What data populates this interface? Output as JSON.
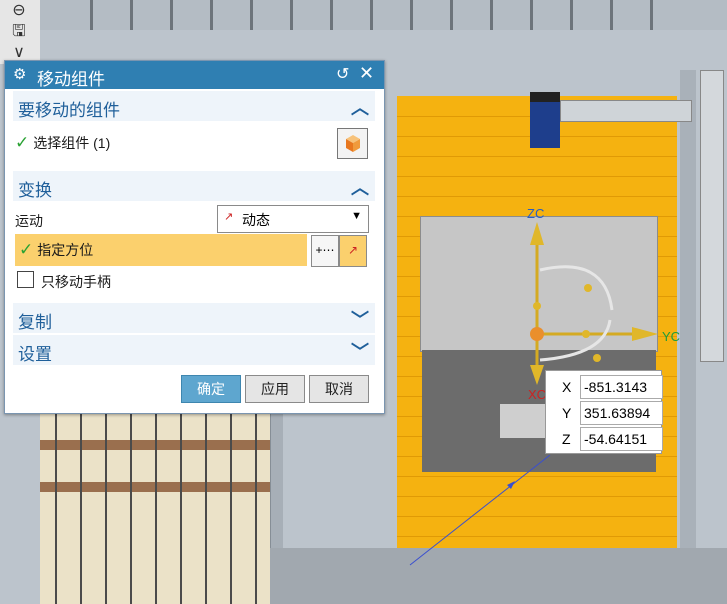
{
  "dialog": {
    "title": "移动组件",
    "sections": {
      "components": {
        "title": "要移动的组件",
        "select_label": "选择组件 (1)"
      },
      "transform": {
        "title": "变换",
        "motion_label": "运动",
        "motion_value": "动态",
        "orientation_label": "指定方位",
        "move_handle_only_label": "只移动手柄"
      },
      "copy": {
        "title": "复制"
      },
      "settings": {
        "title": "设置"
      }
    },
    "buttons": {
      "ok": "确定",
      "apply": "应用",
      "cancel": "取消"
    }
  },
  "viewport": {
    "axes": {
      "z": "ZC",
      "y": "YC",
      "x": "XC"
    },
    "coordinates": {
      "x_label": "X",
      "x_value": "-851.3143",
      "y_label": "Y",
      "y_value": "351.63894",
      "z_label": "Z",
      "z_value": "-54.64151"
    },
    "colors": {
      "title_bar": "#2f7fb2",
      "highlight_row": "#fbd06d",
      "conveyor": "#f5b210",
      "ok_button": "#5ea6cf"
    }
  },
  "icons": [
    "gear-icon",
    "reset-icon",
    "close-icon",
    "check-icon",
    "chevron-up-icon",
    "chevron-down-icon",
    "component-cube-icon",
    "csys-icon",
    "point-dialog-icon",
    "save-icon"
  ]
}
